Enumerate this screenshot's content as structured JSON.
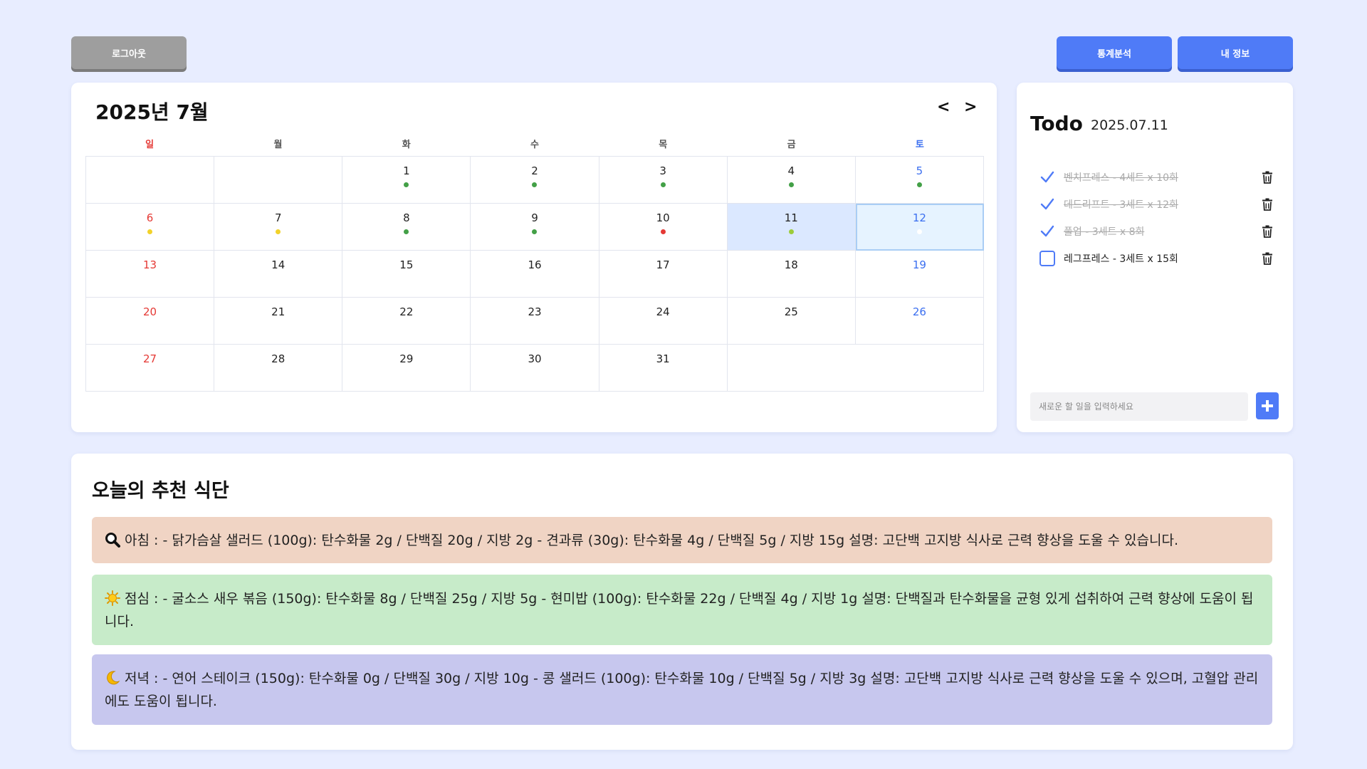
{
  "header": {
    "logout_label": "로그아웃",
    "stats_label": "통계분석",
    "myinfo_label": "내 정보"
  },
  "calendar": {
    "title": "2025년 7월",
    "prev_label": "<",
    "next_label": ">",
    "weekdays": [
      "일",
      "월",
      "화",
      "수",
      "목",
      "금",
      "토"
    ],
    "selected_day": 11,
    "today": 12,
    "days": {
      "1": "green",
      "2": "green",
      "3": "green",
      "4": "green",
      "5": "green",
      "6": "yellow",
      "7": "yellow",
      "8": "green",
      "9": "green",
      "10": "red",
      "11": "yellowgreen",
      "12": "white"
    },
    "colors": {
      "green": "#43a047",
      "yellow": "#f2d22a",
      "red": "#e53935",
      "yellowgreen": "#9ccc3a",
      "white": "#ffffff"
    }
  },
  "todo": {
    "title": "Todo",
    "date": "2025.07.11",
    "items": [
      {
        "text": "벤치프레스 - 4세트 x 10회",
        "done": true
      },
      {
        "text": "데드리프트 - 3세트 x 12회",
        "done": true
      },
      {
        "text": "풀업 - 3세트 x 8회",
        "done": true
      },
      {
        "text": "레그프레스 - 3세트 x 15회",
        "done": false
      }
    ],
    "input_placeholder": "새로운 할 일을 입력하세요"
  },
  "meals": {
    "title": "오늘의 추천 식단",
    "breakfast": "아침 : - 닭가슴살 샐러드 (100g): 탄수화물 2g / 단백질 20g / 지방 2g - 견과류 (30g): 탄수화물 4g / 단백질 5g / 지방 15g 설명: 고단백 고지방 식사로 근력 향상을 도울 수 있습니다.",
    "lunch": "점심 : - 굴소스 새우 볶음 (150g): 탄수화물 8g / 단백질 25g / 지방 5g - 현미밥 (100g): 탄수화물 22g / 단백질 4g / 지방 1g 설명: 단백질과 탄수화물을 균형 있게 섭취하여 근력 향상에 도움이 됩니다.",
    "dinner": "저녁 : - 연어 스테이크 (150g): 탄수화물 0g / 단백질 30g / 지방 10g - 콩 샐러드 (100g): 탄수화물 10g / 단백질 5g / 지방 3g 설명: 고단백 고지방 식사로 근력 향상을 도울 수 있으며, 고혈압 관리에도 도움이 됩니다.",
    "icons": {
      "breakfast": "magnifier-icon",
      "lunch": "sun-icon",
      "dinner": "moon-icon"
    }
  }
}
